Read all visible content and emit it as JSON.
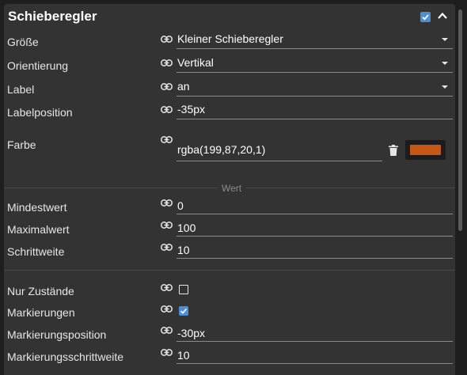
{
  "panel": {
    "title": "Schieberegler",
    "header_checkbox_checked": true,
    "collapse_icon": "chevron-up-icon"
  },
  "rows": {
    "groesse": {
      "label": "Größe",
      "value": "Kleiner Schieberegler"
    },
    "orientierung": {
      "label": "Orientierung",
      "value": "Vertikal"
    },
    "label": {
      "label": "Label",
      "value": "an"
    },
    "labelposition": {
      "label": "Labelposition",
      "value": "-35px"
    },
    "farbe": {
      "label": "Farbe",
      "value": "rgba(199,87,20,1)",
      "swatch_color": "#c75714"
    },
    "mindestwert": {
      "label": "Mindestwert",
      "value": "0"
    },
    "maximalwert": {
      "label": "Maximalwert",
      "value": "100"
    },
    "schrittweite": {
      "label": "Schrittweite",
      "value": "10"
    },
    "nur_zustaende": {
      "label": "Nur Zustände",
      "checked": false
    },
    "markierungen": {
      "label": "Markierungen",
      "checked": true
    },
    "markierungsposition": {
      "label": "Markierungsposition",
      "value": "-30px"
    },
    "markierungsschrittweite": {
      "label": "Markierungsschrittweite",
      "value": "10"
    }
  },
  "sections": {
    "wert": "Wert"
  },
  "colors": {
    "accent": "#4a90d9",
    "panel_bg": "#333333"
  },
  "icons": {
    "link": "link-icon",
    "delete": "trash-icon"
  }
}
